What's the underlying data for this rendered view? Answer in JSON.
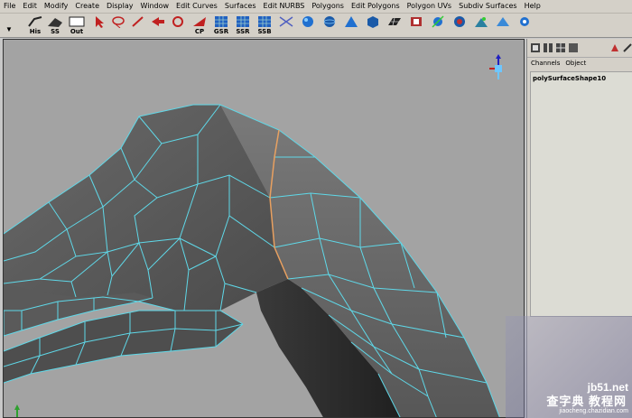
{
  "menubar": {
    "items": [
      "File",
      "Edit",
      "Modify",
      "Create",
      "Display",
      "Window",
      "Edit Curves",
      "Surfaces",
      "Edit NURBS",
      "Polygons",
      "Edit Polygons",
      "Polygon UVs",
      "Subdiv Surfaces",
      "Help"
    ]
  },
  "shelf": {
    "his_label": "His",
    "ss_label": "SS",
    "out_label": "Out",
    "cp_label": "CP",
    "gsr_label": "GSR",
    "ssr_label": "SSR",
    "ssb_label": "SSB"
  },
  "channel_box": {
    "tabs": [
      "Channels",
      "Object"
    ],
    "node_name": "polySurfaceShape10"
  },
  "watermark": {
    "top": "jb51.net",
    "main": "查字典 教程网",
    "sub": "jiaocheng.chazidian.com"
  },
  "colors": {
    "wire": "#5fd8e8",
    "selected_edge": "#e8a060",
    "viewport_bg": "#a3a3a3"
  }
}
